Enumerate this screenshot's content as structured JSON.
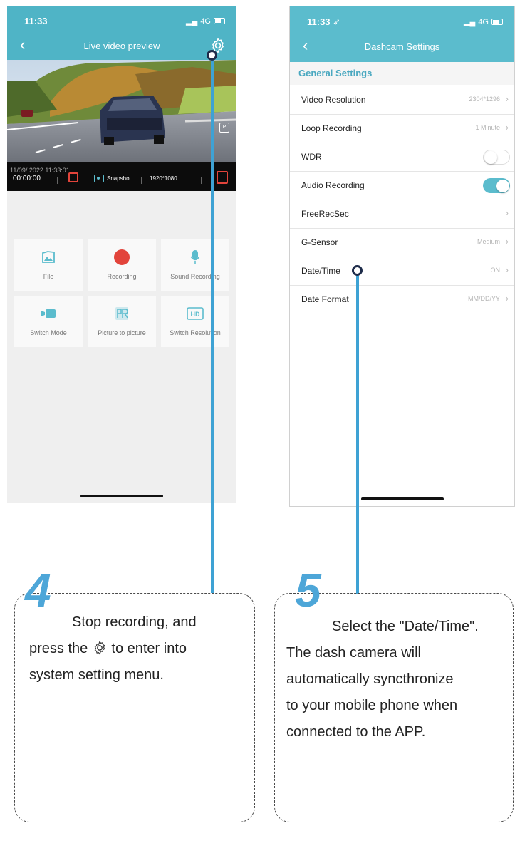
{
  "phone_left": {
    "status_time": "11:33",
    "signal": "4G",
    "nav_title": "Live video preview",
    "video_overlay": {
      "date": "11/09/ 2022 11:33:01",
      "elapsed": "00:00:00",
      "snapshot_label": "Snapshot",
      "resolution": "1920*1080"
    },
    "tiles": [
      {
        "label": "File",
        "icon": "file-icon"
      },
      {
        "label": "Recording",
        "icon": "record-icon"
      },
      {
        "label": "Sound Recording",
        "icon": "microphone-icon"
      },
      {
        "label": "Switch Mode",
        "icon": "switch-mode-icon"
      },
      {
        "label": "Picture to picture",
        "icon": "pip-icon"
      },
      {
        "label": "Switch Resolution",
        "icon": "hd-icon"
      }
    ]
  },
  "phone_right": {
    "status_time": "11:33",
    "signal": "4G",
    "nav_title": "Dashcam Settings",
    "section_header": "General Settings",
    "rows": [
      {
        "label": "Video Resolution",
        "value": "2304*1296"
      },
      {
        "label": "Loop Recording",
        "value": "1 Minute"
      },
      {
        "label": "WDR",
        "toggle": "off"
      },
      {
        "label": "Audio Recording",
        "toggle": "on"
      },
      {
        "label": "FreeRecSec",
        "value": ""
      },
      {
        "label": "G-Sensor",
        "value": "Medium"
      },
      {
        "label": "Date/Time",
        "value": "ON"
      },
      {
        "label": "Date Format",
        "value": "MM/DD/YY"
      }
    ]
  },
  "steps": [
    {
      "number": "4",
      "line1": "Stop recording, and",
      "line2_before": "press the",
      "line2_after": "to enter into",
      "line3": "system setting menu."
    },
    {
      "number": "5",
      "line1": "Select the \"Date/Time\".",
      "line2": "The dash camera will",
      "line3": "automatically syncthronize",
      "line4": "to your mobile phone when",
      "line5": "connected to the APP."
    }
  ],
  "colors": {
    "accent": "#5bbccd",
    "callout_line": "#3ea2d4",
    "step_number": "#4da6d8",
    "record_red": "#e2443b"
  }
}
